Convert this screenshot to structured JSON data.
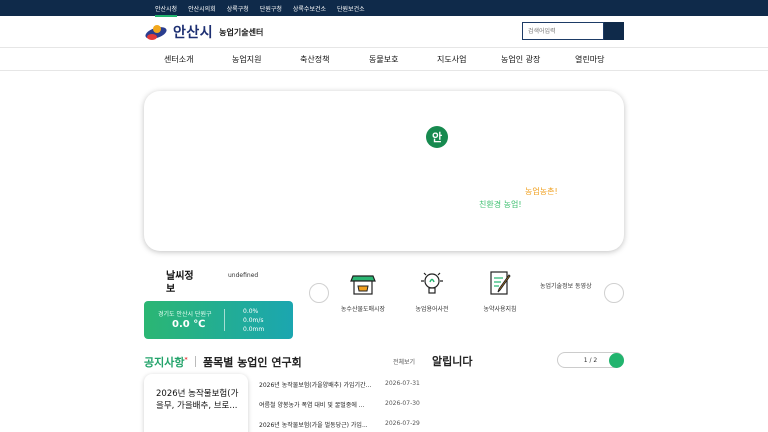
{
  "topbar": {
    "links": [
      "안산시청",
      "안산시의회",
      "상록구청",
      "단원구청",
      "상록수보건소",
      "단원보건소"
    ],
    "accent_color": "#22b46e",
    "bg_color": "#0f2a4a"
  },
  "header": {
    "logo_name": "안산시",
    "logo_sub": "농업기술센터",
    "search_placeholder": "검색어입력"
  },
  "nav": {
    "items": [
      "센터소개",
      "농업지원",
      "축산정책",
      "동물보호",
      "지도사업",
      "농업인 광장",
      "열린마당"
    ]
  },
  "hero": {
    "badge": "안",
    "line1": "농업농촌!",
    "line2": "친환경 농업!"
  },
  "weather": {
    "title": "날씨정보",
    "undefined_text": "undefined",
    "location": "경기도 안산시 단원구",
    "temperature": "0.0 ℃",
    "metrics": [
      "0.0%",
      "0.0m/s",
      "0.0mm"
    ]
  },
  "quick_links": {
    "items": [
      {
        "label": "농수산물도매시장",
        "icon": "market-icon"
      },
      {
        "label": "농업용어사전",
        "icon": "lightbulb-icon"
      },
      {
        "label": "농약사용지침",
        "icon": "document-pen-icon"
      }
    ],
    "extra": "농업기술정보 동영상"
  },
  "notices": {
    "tab_notice": "공지사항",
    "tab_notice_mark": "*",
    "tab_research": "품목별 농업인 연구회",
    "more": "전체보기",
    "featured": "2026년 농작물보험(가을무, 가을배추, 브로...",
    "rows": [
      {
        "title": "2026년 농작물보험(가을양배추) 가입기간...",
        "date": "2026-07-31"
      },
      {
        "title": "여름철 양봉농가 폭염 대비 및 꿀벌중에 ...",
        "date": "2026-07-30"
      },
      {
        "title": "2026년 농작물보험(가을 벌동당근) 가입...",
        "date": "2026-07-29"
      }
    ]
  },
  "alarm": {
    "title": "알립니다",
    "pager": "1 / 2"
  }
}
